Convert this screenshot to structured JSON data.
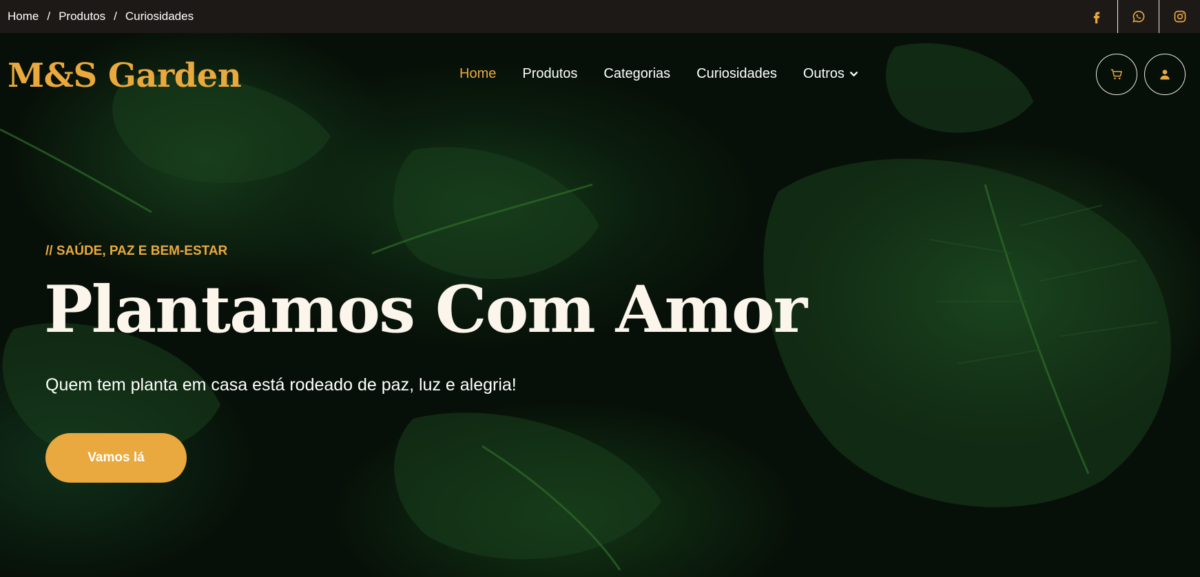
{
  "breadcrumb": {
    "items": [
      "Home",
      "Produtos",
      "Curiosidades"
    ],
    "separator": "/"
  },
  "socials": [
    {
      "icon": "facebook-icon"
    },
    {
      "icon": "whatsapp-icon"
    },
    {
      "icon": "instagram-icon"
    }
  ],
  "brand": {
    "logo_text": "M&S Garden",
    "accent_color": "#eaa93e"
  },
  "nav": {
    "items": [
      "Home",
      "Produtos",
      "Categorias",
      "Curiosidades",
      "Outros"
    ],
    "active": "Home",
    "dropdown_icon": "chevron-down-icon"
  },
  "actions": {
    "cart_icon": "cart-icon",
    "user_icon": "user-icon"
  },
  "hero": {
    "tagline": "// SAÚDE, PAZ E BEM-ESTAR",
    "headline": "Plantamos Com Amor",
    "subtitle": "Quem tem planta em casa está rodeado de paz, luz e alegria!",
    "cta_label": "Vamos lá"
  }
}
